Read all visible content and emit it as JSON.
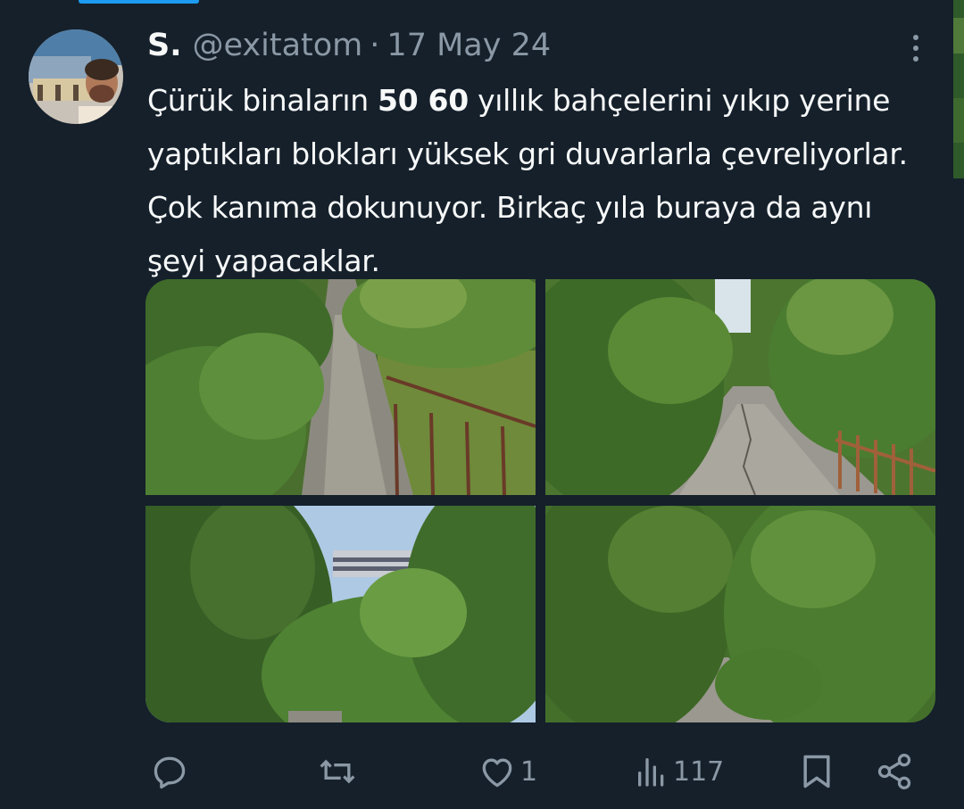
{
  "tweet": {
    "author_name": "S.",
    "handle": "@exitatom",
    "separator": "·",
    "date": "17 May 24",
    "text_before": "Çürük binaların ",
    "text_bold": "50 60",
    "text_after": " yıllık bahçelerini yıkıp yerine yaptıkları blokları yüksek gri duvarlarla çevreliyorlar. Çok kanıma dokunuyor. Birkaç yıla buraya da aynı şeyi yapacaklar."
  },
  "actions": {
    "reply_count": "",
    "retweet_count": "",
    "like_count": "1",
    "views_count": "117"
  },
  "icons": {
    "more": "more-dots-icon",
    "reply": "reply-icon",
    "retweet": "retweet-icon",
    "like": "heart-icon",
    "views": "views-icon",
    "bookmark": "bookmark-icon",
    "share": "share-icon"
  },
  "colors": {
    "background": "#15202b",
    "text_primary": "#f7f9f9",
    "text_secondary": "#8b98a5",
    "accent": "#1d9bf0"
  }
}
